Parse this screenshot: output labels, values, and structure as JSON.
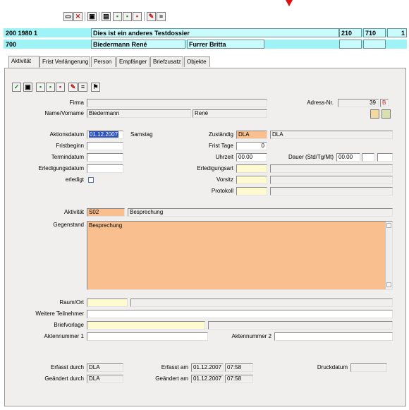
{
  "header": {
    "row1": {
      "id": "200 1980 1",
      "title": "Dies ist ein anderes Testdossier",
      "code1": "210",
      "code2": "710",
      "code3": "1"
    },
    "row2": {
      "id": "700",
      "name1": "Biedermann René",
      "name2": "Furrer Britta"
    }
  },
  "tabs": [
    "Aktivität",
    "Frist Verlängerung",
    "Person",
    "Empfänger",
    "Briefzusatz",
    "Objekte"
  ],
  "person": {
    "firma_label": "Firma",
    "name_label": "Name/Vorname",
    "name_last": "Biedermann",
    "name_first": "René",
    "adress_label": "Adress-Nr.",
    "adress_nr": "39",
    "adress_flag": "B"
  },
  "aktion": {
    "aktionsdatum_label": "Aktionsdatum",
    "aktionsdatum": "01.12.2007",
    "wochentag": "Samstag",
    "fristbeginn_label": "Fristbeginn",
    "termindatum_label": "Termindatum",
    "erledigungsdatum_label": "Erledigungsdatum",
    "erledigt_label": "erledigt",
    "zustaendig_label": "Zuständig",
    "zustaendig_code": "DLA",
    "zustaendig_name": "DLA",
    "frist_tage_label": "Frist Tage",
    "frist_tage": "0",
    "uhrzeit_label": "Uhrzeit",
    "uhrzeit": "00.00",
    "dauer_label": "Dauer (Std/Tg/Mt)",
    "dauer": "00.00",
    "erledigungsart_label": "Erledigungsart",
    "vorsitz_label": "Vorsitz",
    "protokoll_label": "Protokoll"
  },
  "aktivitaet": {
    "label": "Aktivität",
    "code": "S02",
    "name": "Besprechung",
    "gegenstand_label": "Gegenstand",
    "gegenstand": "Besprechung"
  },
  "details": {
    "raum_label": "Raum/Ort",
    "teilnehmer_label": "Weitere Teilnehmer",
    "briefvorlage_label": "Briefvorlage",
    "aktennummer1_label": "Aktennummer 1",
    "aktennummer2_label": "Aktennummer 2"
  },
  "audit": {
    "erfasst_durch_label": "Erfasst durch",
    "erfasst_durch": "DLA",
    "geaendert_durch_label": "Geändert durch",
    "geaendert_durch": "DLA",
    "erfasst_am_label": "Erfasst am",
    "erfasst_am_date": "01.12.2007",
    "erfasst_am_time": "07:58",
    "geaendert_am_label": "Geändert am",
    "geaendert_am_date": "01.12.2007",
    "geaendert_am_time": "07:58",
    "druckdatum_label": "Druckdatum"
  }
}
